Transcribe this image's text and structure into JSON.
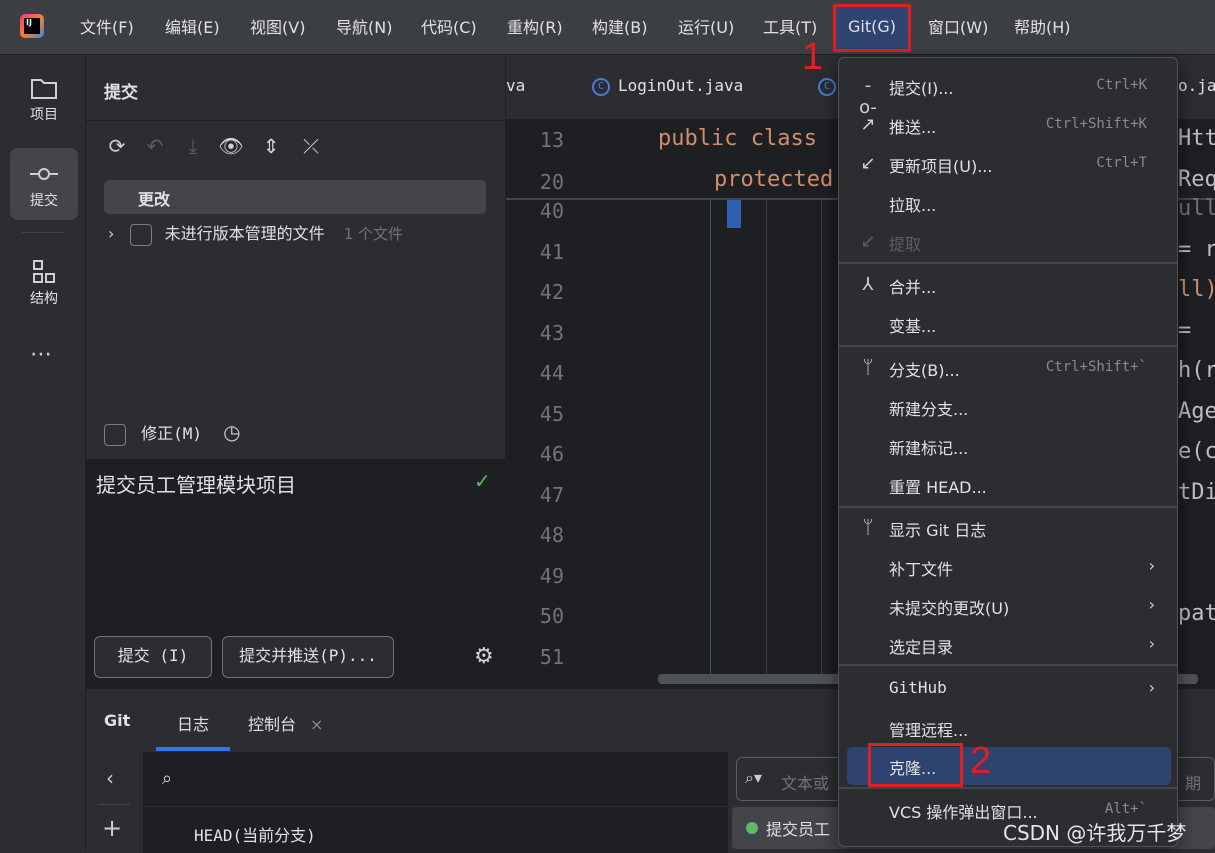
{
  "menubar": {
    "items": [
      "文件(F)",
      "编辑(E)",
      "视图(V)",
      "导航(N)",
      "代码(C)",
      "重构(R)",
      "构建(B)",
      "运行(U)",
      "工具(T)",
      "Git(G)",
      "窗口(W)",
      "帮助(H)"
    ]
  },
  "toolstrip": {
    "project": "项目",
    "commit": "提交",
    "structure": "结构",
    "more": "⋯"
  },
  "commit_panel": {
    "title": "提交",
    "changes_label": "更改",
    "unversioned_label": "未进行版本管理的文件",
    "unversioned_count": "1 个文件",
    "amend_label": "修正(M)",
    "message": "提交员工管理模块项目",
    "commit_button": "提交 (I)",
    "commit_push_button": "提交并推送(P)..."
  },
  "editor": {
    "tabs": [
      "va",
      "LoginOut.java",
      "C",
      "o.jav"
    ],
    "line_numbers": [
      "13",
      "20",
      "40",
      "41",
      "42",
      "43",
      "44",
      "45",
      "46",
      "47",
      "48",
      "49",
      "50",
      "51"
    ],
    "code_13": "public class",
    "code_20": "protected",
    "right_fragments": [
      "Htt",
      "Req",
      "ull",
      "= r",
      "ll)",
      " = ",
      "h(r",
      "Age",
      "e(c",
      "tDi",
      "pat"
    ]
  },
  "bottom_panel": {
    "tabs": [
      "Git",
      "日志",
      "控制台"
    ],
    "close_glyph": "×",
    "head_label": "HEAD(当前分支)",
    "filter_placeholder": "文本或",
    "filter_suffix": "期",
    "commit_entry": "提交员工"
  },
  "git_menu": {
    "items": [
      {
        "icon": "commit-icon",
        "label": "提交(I)...",
        "shortcut": "Ctrl+K"
      },
      {
        "icon": "push-icon",
        "label": "推送...",
        "shortcut": "Ctrl+Shift+K"
      },
      {
        "icon": "update-icon",
        "label": "更新项目(U)...",
        "shortcut": "Ctrl+T"
      },
      {
        "label": "拉取..."
      },
      {
        "icon": "fetch-icon",
        "label": "提取",
        "disabled": true
      },
      {
        "icon": "merge-icon",
        "label": "合并..."
      },
      {
        "label": "变基..."
      },
      {
        "icon": "branch-icon",
        "label": "分支(B)...",
        "shortcut": "Ctrl+Shift+`"
      },
      {
        "label": "新建分支..."
      },
      {
        "label": "新建标记..."
      },
      {
        "label": "重置 HEAD..."
      },
      {
        "icon": "branch-icon",
        "label": "显示 Git 日志"
      },
      {
        "label": "补丁文件",
        "submenu": true
      },
      {
        "label": "未提交的更改(U)",
        "submenu": true
      },
      {
        "label": "选定目录",
        "submenu": true
      },
      {
        "label": "GitHub",
        "submenu": true
      },
      {
        "label": "管理远程..."
      },
      {
        "label": "克隆..."
      },
      {
        "label": "VCS 操作弹出窗口...",
        "shortcut": "Alt+`"
      }
    ]
  },
  "annotations": {
    "step1": "1",
    "step2": "2"
  },
  "watermark": "CSDN @许我万千梦",
  "colors": {
    "accent": "#3574f0",
    "highlight_red": "#e02020",
    "menu_hover": "#2e436e",
    "keyword": "#cf8e6d"
  }
}
